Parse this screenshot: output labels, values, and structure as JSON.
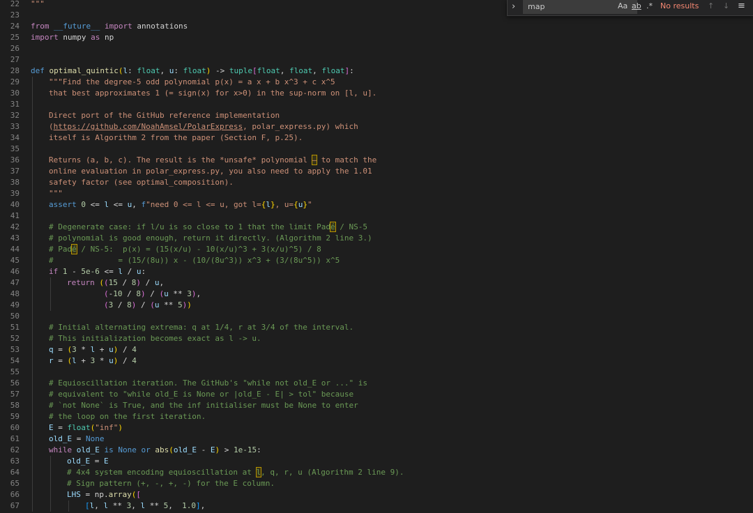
{
  "find_widget": {
    "toggle_label": "›",
    "query": "map",
    "match_case_label": "Aa",
    "whole_word_label": "ab",
    "regex_label": ".*",
    "results": "No results",
    "prev_label": "↑",
    "next_label": "↓",
    "menu_label": "≡"
  },
  "editor": {
    "lines": [
      {
        "n": "22",
        "indent": 0,
        "tokens": [
          [
            "str",
            "\"\"\""
          ]
        ]
      },
      {
        "n": "23",
        "indent": 0,
        "tokens": []
      },
      {
        "n": "24",
        "indent": 0,
        "tokens": [
          [
            "ctrl",
            "from "
          ],
          [
            "kw",
            "__future__"
          ],
          [
            "ctrl",
            " import "
          ],
          [
            "",
            "annotations"
          ]
        ]
      },
      {
        "n": "25",
        "indent": 0,
        "tokens": [
          [
            "ctrl",
            "import "
          ],
          [
            "",
            "numpy "
          ],
          [
            "ctrl",
            "as "
          ],
          [
            "",
            "np"
          ]
        ]
      },
      {
        "n": "26",
        "indent": 0,
        "tokens": []
      },
      {
        "n": "27",
        "indent": 0,
        "tokens": []
      },
      {
        "n": "28",
        "indent": 0,
        "tokens": [
          [
            "kw",
            "def "
          ],
          [
            "fn",
            "optimal_quintic"
          ],
          [
            "br1",
            "("
          ],
          [
            "var",
            "l"
          ],
          [
            "",
            ": "
          ],
          [
            "ty",
            "float"
          ],
          [
            "",
            ", "
          ],
          [
            "var",
            "u"
          ],
          [
            "",
            ": "
          ],
          [
            "ty",
            "float"
          ],
          [
            "br1",
            ")"
          ],
          [
            "",
            " -> "
          ],
          [
            "ty",
            "tuple"
          ],
          [
            "br2",
            "["
          ],
          [
            "ty",
            "float"
          ],
          [
            "",
            ", "
          ],
          [
            "ty",
            "float"
          ],
          [
            "",
            ", "
          ],
          [
            "ty",
            "float"
          ],
          [
            "br2",
            "]"
          ],
          [
            "",
            ":"
          ]
        ]
      },
      {
        "n": "29",
        "indent": 1,
        "tokens": [
          [
            "str",
            "\"\"\"Find the degree-5 odd polynomial p(x) = a x + b x^3 + c x^5"
          ]
        ]
      },
      {
        "n": "30",
        "indent": 1,
        "tokens": [
          [
            "str",
            "that best approximates 1 (= sign(x) for x>0) in the sup-norm on [l, u]."
          ]
        ]
      },
      {
        "n": "31",
        "indent": 1,
        "tokens": []
      },
      {
        "n": "32",
        "indent": 1,
        "tokens": [
          [
            "str",
            "Direct port of the GitHub reference implementation"
          ]
        ]
      },
      {
        "n": "33",
        "indent": 1,
        "tokens": [
          [
            "str",
            "("
          ],
          [
            "str url",
            "https://github.com/NoahAmsel/PolarExpress"
          ],
          [
            "str",
            ", polar_express.py) which"
          ]
        ]
      },
      {
        "n": "34",
        "indent": 1,
        "tokens": [
          [
            "str",
            "itself is Algorithm 2 from the paper (Section F, p.25)."
          ]
        ]
      },
      {
        "n": "35",
        "indent": 1,
        "tokens": []
      },
      {
        "n": "36",
        "indent": 1,
        "tokens": [
          [
            "str",
            "Returns (a, b, c). The result is the *unsafe* polynomial "
          ],
          [
            "str hl",
            "—"
          ],
          [
            "str",
            " to match the"
          ]
        ]
      },
      {
        "n": "37",
        "indent": 1,
        "tokens": [
          [
            "str",
            "online evaluation in polar_express.py, you also need to apply the 1.01"
          ]
        ]
      },
      {
        "n": "38",
        "indent": 1,
        "tokens": [
          [
            "str",
            "safety factor (see optimal_composition)."
          ]
        ]
      },
      {
        "n": "39",
        "indent": 1,
        "tokens": [
          [
            "str",
            "\"\"\""
          ]
        ]
      },
      {
        "n": "40",
        "indent": 1,
        "tokens": [
          [
            "kw",
            "assert "
          ],
          [
            "num",
            "0"
          ],
          [
            "",
            " <= "
          ],
          [
            "var",
            "l"
          ],
          [
            "",
            " <= "
          ],
          [
            "var",
            "u"
          ],
          [
            "",
            ", "
          ],
          [
            "kw",
            "f"
          ],
          [
            "str",
            "\"need 0 <= l <= u, got l="
          ],
          [
            "br1",
            "{"
          ],
          [
            "var",
            "l"
          ],
          [
            "br1",
            "}"
          ],
          [
            "str",
            ", u="
          ],
          [
            "br1",
            "{"
          ],
          [
            "var",
            "u"
          ],
          [
            "br1",
            "}"
          ],
          [
            "str",
            "\""
          ]
        ]
      },
      {
        "n": "41",
        "indent": 1,
        "tokens": []
      },
      {
        "n": "42",
        "indent": 1,
        "tokens": [
          [
            "cmt",
            "# Degenerate case: if l/u is so close to 1 that the limit Pad"
          ],
          [
            "cmt hl",
            "é"
          ],
          [
            "cmt",
            " / NS-5"
          ]
        ]
      },
      {
        "n": "43",
        "indent": 1,
        "tokens": [
          [
            "cmt",
            "# polynomial is good enough, return it directly. (Algorithm 2 line 3.)"
          ]
        ]
      },
      {
        "n": "44",
        "indent": 1,
        "tokens": [
          [
            "cmt",
            "# Pad"
          ],
          [
            "cmt hl",
            "é"
          ],
          [
            "cmt",
            " / NS-5:  p(x) = (15(x/u) - 10(x/u)^3 + 3(x/u)^5) / 8"
          ]
        ]
      },
      {
        "n": "45",
        "indent": 1,
        "tokens": [
          [
            "cmt",
            "#              = (15/(8u)) x - (10/(8u^3)) x^3 + (3/(8u^5)) x^5"
          ]
        ]
      },
      {
        "n": "46",
        "indent": 1,
        "tokens": [
          [
            "ctrl",
            "if "
          ],
          [
            "num",
            "1"
          ],
          [
            "",
            " - "
          ],
          [
            "num",
            "5e-6"
          ],
          [
            "",
            " <= "
          ],
          [
            "var",
            "l"
          ],
          [
            "",
            " / "
          ],
          [
            "var",
            "u"
          ],
          [
            "",
            ":"
          ]
        ]
      },
      {
        "n": "47",
        "indent": 2,
        "tokens": [
          [
            "ctrl",
            "return "
          ],
          [
            "br1",
            "("
          ],
          [
            "br2",
            "("
          ],
          [
            "num",
            "15"
          ],
          [
            "",
            " / "
          ],
          [
            "num",
            "8"
          ],
          [
            "br2",
            ")"
          ],
          [
            "",
            " / "
          ],
          [
            "var",
            "u"
          ],
          [
            "",
            ","
          ]
        ]
      },
      {
        "n": "48",
        "indent": 2,
        "tokens": [
          [
            "",
            "        "
          ],
          [
            "br2",
            "("
          ],
          [
            "",
            "-"
          ],
          [
            "num",
            "10"
          ],
          [
            "",
            " / "
          ],
          [
            "num",
            "8"
          ],
          [
            "br2",
            ")"
          ],
          [
            "",
            " / "
          ],
          [
            "br2",
            "("
          ],
          [
            "var",
            "u"
          ],
          [
            "",
            " ** "
          ],
          [
            "num",
            "3"
          ],
          [
            "br2",
            ")"
          ],
          [
            "",
            ","
          ]
        ]
      },
      {
        "n": "49",
        "indent": 2,
        "tokens": [
          [
            "",
            "        "
          ],
          [
            "br2",
            "("
          ],
          [
            "num",
            "3"
          ],
          [
            "",
            " / "
          ],
          [
            "num",
            "8"
          ],
          [
            "br2",
            ")"
          ],
          [
            "",
            " / "
          ],
          [
            "br2",
            "("
          ],
          [
            "var",
            "u"
          ],
          [
            "",
            " ** "
          ],
          [
            "num",
            "5"
          ],
          [
            "br2",
            ")"
          ],
          [
            "br1",
            ")"
          ]
        ]
      },
      {
        "n": "50",
        "indent": 1,
        "tokens": []
      },
      {
        "n": "51",
        "indent": 1,
        "tokens": [
          [
            "cmt",
            "# Initial alternating extrema: q at 1/4, r at 3/4 of the interval."
          ]
        ]
      },
      {
        "n": "52",
        "indent": 1,
        "tokens": [
          [
            "cmt",
            "# This initialization becomes exact as l -> u."
          ]
        ]
      },
      {
        "n": "53",
        "indent": 1,
        "tokens": [
          [
            "var",
            "q"
          ],
          [
            "",
            " = "
          ],
          [
            "br1",
            "("
          ],
          [
            "num",
            "3"
          ],
          [
            "",
            " * "
          ],
          [
            "var",
            "l"
          ],
          [
            "",
            " + "
          ],
          [
            "var",
            "u"
          ],
          [
            "br1",
            ")"
          ],
          [
            "",
            " / "
          ],
          [
            "num",
            "4"
          ]
        ]
      },
      {
        "n": "54",
        "indent": 1,
        "tokens": [
          [
            "var",
            "r"
          ],
          [
            "",
            " = "
          ],
          [
            "br1",
            "("
          ],
          [
            "var",
            "l"
          ],
          [
            "",
            " + "
          ],
          [
            "num",
            "3"
          ],
          [
            "",
            " * "
          ],
          [
            "var",
            "u"
          ],
          [
            "br1",
            ")"
          ],
          [
            "",
            " / "
          ],
          [
            "num",
            "4"
          ]
        ]
      },
      {
        "n": "55",
        "indent": 1,
        "tokens": []
      },
      {
        "n": "56",
        "indent": 1,
        "tokens": [
          [
            "cmt",
            "# Equioscillation iteration. The GitHub's \"while not old_E or ...\" is"
          ]
        ]
      },
      {
        "n": "57",
        "indent": 1,
        "tokens": [
          [
            "cmt",
            "# equivalent to \"while old_E is None or |old_E - E| > tol\" because"
          ]
        ]
      },
      {
        "n": "58",
        "indent": 1,
        "tokens": [
          [
            "cmt",
            "# `not None` is True, and the inf initialiser must be None to enter"
          ]
        ]
      },
      {
        "n": "59",
        "indent": 1,
        "tokens": [
          [
            "cmt",
            "# the loop on the first iteration."
          ]
        ]
      },
      {
        "n": "60",
        "indent": 1,
        "tokens": [
          [
            "var",
            "E"
          ],
          [
            "",
            " = "
          ],
          [
            "ty",
            "float"
          ],
          [
            "br1",
            "("
          ],
          [
            "str",
            "\"inf\""
          ],
          [
            "br1",
            ")"
          ]
        ]
      },
      {
        "n": "61",
        "indent": 1,
        "tokens": [
          [
            "var",
            "old_E"
          ],
          [
            "",
            " = "
          ],
          [
            "kw",
            "None"
          ]
        ]
      },
      {
        "n": "62",
        "indent": 1,
        "tokens": [
          [
            "ctrl",
            "while "
          ],
          [
            "var",
            "old_E"
          ],
          [
            "kw",
            " is None "
          ],
          [
            "kw",
            "or "
          ],
          [
            "fn",
            "abs"
          ],
          [
            "br1",
            "("
          ],
          [
            "var",
            "old_E"
          ],
          [
            "",
            " - "
          ],
          [
            "var",
            "E"
          ],
          [
            "br1",
            ")"
          ],
          [
            "",
            " > "
          ],
          [
            "num",
            "1e-15"
          ],
          [
            "",
            ":"
          ]
        ]
      },
      {
        "n": "63",
        "indent": 2,
        "tokens": [
          [
            "var",
            "old_E"
          ],
          [
            "",
            " = "
          ],
          [
            "var",
            "E"
          ]
        ]
      },
      {
        "n": "64",
        "indent": 2,
        "tokens": [
          [
            "cmt",
            "# 4x4 system encoding equioscillation at "
          ],
          [
            "cmt hl",
            "l"
          ],
          [
            "cmt",
            ", q, r, u (Algorithm 2 line 9)."
          ]
        ]
      },
      {
        "n": "65",
        "indent": 2,
        "tokens": [
          [
            "cmt",
            "# Sign pattern (+, -, +, -) for the E column."
          ]
        ]
      },
      {
        "n": "66",
        "indent": 2,
        "tokens": [
          [
            "var",
            "LHS"
          ],
          [
            "",
            " = "
          ],
          [
            "",
            "np"
          ],
          [
            "",
            "."
          ],
          [
            "fn",
            "array"
          ],
          [
            "br1",
            "("
          ],
          [
            "br2",
            "["
          ]
        ]
      },
      {
        "n": "67",
        "indent": 3,
        "tokens": [
          [
            "br3",
            "["
          ],
          [
            "var",
            "l"
          ],
          [
            "",
            ", "
          ],
          [
            "var",
            "l"
          ],
          [
            "",
            " ** "
          ],
          [
            "num",
            "3"
          ],
          [
            "",
            ", "
          ],
          [
            "var",
            "l"
          ],
          [
            "",
            " ** "
          ],
          [
            "num",
            "5"
          ],
          [
            "",
            ",  "
          ],
          [
            "num",
            "1.0"
          ],
          [
            "br3",
            "]"
          ],
          [
            "",
            ","
          ]
        ]
      }
    ]
  }
}
